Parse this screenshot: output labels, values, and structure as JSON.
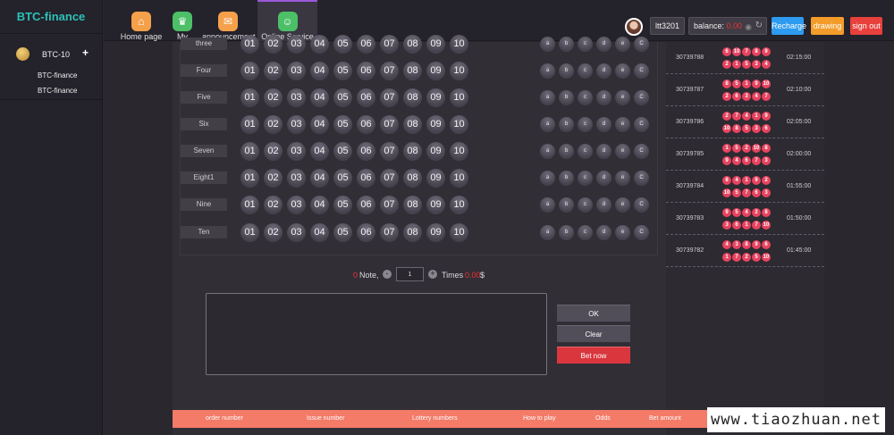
{
  "app": {
    "brand": "BTC-finance"
  },
  "nav": [
    {
      "label": "Home page",
      "icon": "home-icon",
      "color": "#f5a04a"
    },
    {
      "label": "My",
      "icon": "crown-icon",
      "color": "#4cbf67"
    },
    {
      "label": "announcement",
      "icon": "mail-icon",
      "color": "#f5a04a"
    },
    {
      "label": "Online Service",
      "icon": "service-icon",
      "color": "#4cbf67"
    }
  ],
  "user": {
    "name": "ltt3201",
    "balance_label": "balance:",
    "balance_value": "0.00",
    "recharge": "Recharge",
    "drawing": "drawing",
    "signout": "sign out",
    "recharge_color": "#2d9bf0",
    "drawing_color": "#f39c2a",
    "signout_color": "#e8403c"
  },
  "sidebar": {
    "lottery": "BTC-10",
    "plus": "+",
    "items": [
      "BTC-finance",
      "BTC-finance"
    ]
  },
  "grid": {
    "rows": [
      "three",
      "Four",
      "Five",
      "Six",
      "Seven",
      "Eight1",
      "Nine",
      "Ten"
    ],
    "numbers": [
      "01",
      "02",
      "03",
      "04",
      "05",
      "06",
      "07",
      "08",
      "09",
      "10"
    ],
    "options": [
      "a",
      "b",
      "c",
      "d",
      "e",
      "C"
    ]
  },
  "note": {
    "count": "0",
    "note_label": "Note,",
    "minus": "-",
    "plus": "+",
    "times_value": "1",
    "times_label": "Times",
    "amount": "0.00",
    "currency": "$"
  },
  "actions": {
    "ok": "OK",
    "clear": "Clear",
    "bet": "Bet now",
    "bet_color": "#d9363e"
  },
  "history": [
    {
      "issue": "30739788",
      "time": "02:15:00",
      "row1": [
        "6",
        "10",
        "7",
        "8",
        "9"
      ],
      "row2": [
        "2",
        "1",
        "5",
        "3",
        "4"
      ]
    },
    {
      "issue": "30739787",
      "time": "02:10:00",
      "row1": [
        "8",
        "5",
        "1",
        "9",
        "10"
      ],
      "row2": [
        "2",
        "6",
        "3",
        "4",
        "7"
      ]
    },
    {
      "issue": "30739786",
      "time": "02:05:00",
      "row1": [
        "2",
        "7",
        "4",
        "1",
        "9"
      ],
      "row2": [
        "10",
        "8",
        "5",
        "3",
        "6"
      ]
    },
    {
      "issue": "30739785",
      "time": "02:00:00",
      "row1": [
        "1",
        "5",
        "2",
        "10",
        "8"
      ],
      "row2": [
        "9",
        "4",
        "6",
        "7",
        "3"
      ]
    },
    {
      "issue": "30739784",
      "time": "01:55:00",
      "row1": [
        "8",
        "4",
        "1",
        "9",
        "2"
      ],
      "row2": [
        "10",
        "5",
        "7",
        "6",
        "3"
      ]
    },
    {
      "issue": "30739783",
      "time": "01:50:00",
      "row1": [
        "9",
        "5",
        "4",
        "2",
        "8"
      ],
      "row2": [
        "3",
        "6",
        "1",
        "7",
        "10"
      ]
    },
    {
      "issue": "30739782",
      "time": "01:45:00",
      "row1": [
        "4",
        "3",
        "8",
        "9",
        "6"
      ],
      "row2": [
        "1",
        "7",
        "2",
        "5",
        "10"
      ]
    }
  ],
  "footer": {
    "columns": [
      "order number",
      "Issue number",
      "Lottery numbers",
      "How to play",
      "Odds",
      "Bet amount"
    ]
  },
  "watermark": "www.tiaozhuan.net"
}
